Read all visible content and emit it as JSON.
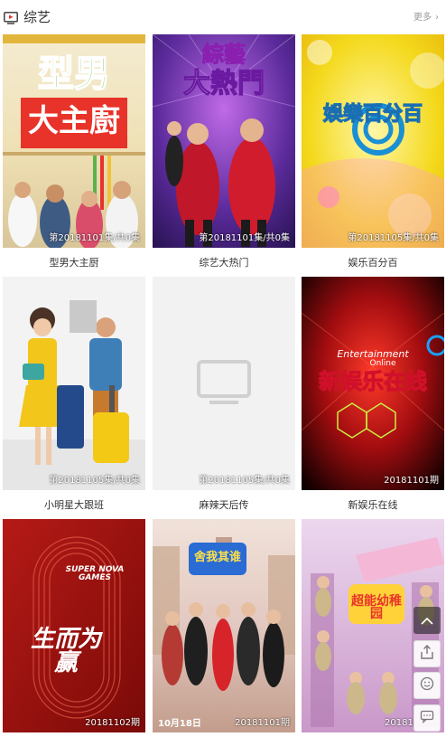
{
  "header": {
    "title": "综艺",
    "more_label": "更多",
    "more_chevron": "›"
  },
  "cards": [
    {
      "caption": "型男大主厨",
      "badge": "第20181101集/共0集",
      "poster_text_1": "型男",
      "poster_text_2": "大主廚"
    },
    {
      "caption": "综艺大热门",
      "badge": "第20181101集/共0集",
      "poster_text_1": "綜藝",
      "poster_text_2": "大熱門"
    },
    {
      "caption": "娱乐百分百",
      "badge": "第20181105集/共0集",
      "poster_text_1": "娛樂百分百"
    },
    {
      "caption": "小明星大跟班",
      "badge": "第20181105集/共0集"
    },
    {
      "caption": "麻辣天后传",
      "badge": "第20181105集/共0集"
    },
    {
      "caption": "新娱乐在线",
      "badge": "20181101期",
      "poster_text_1": "Entertainment",
      "poster_text_2": "Online",
      "poster_text_3": "新娱乐在线"
    },
    {
      "badge": "20181102期",
      "poster_text_1": "SUPER NOVA GAMES",
      "poster_text_2": "生而为赢"
    },
    {
      "badge": "20181101期",
      "poster_text_1": "舍我其谁",
      "poster_text_2": "10月18日"
    },
    {
      "badge": "20181",
      "poster_text_1": "超能幼稚园"
    }
  ],
  "colors": {
    "accent": "#e8332a",
    "badge_text": "#ffffff",
    "caption_text": "#333333"
  }
}
